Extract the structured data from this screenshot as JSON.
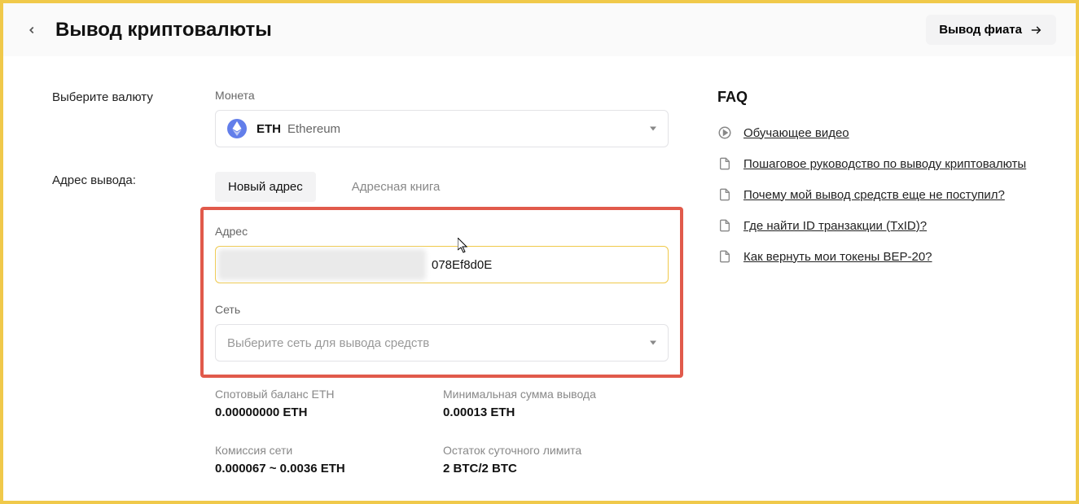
{
  "header": {
    "title": "Вывод криптовалюты",
    "fiat_button": "Вывод фиата"
  },
  "currency": {
    "section_label": "Выберите валюту",
    "field_caption": "Монета",
    "symbol": "ETH",
    "name": "Ethereum"
  },
  "withdraw": {
    "section_label": "Адрес вывода:",
    "tabs": {
      "new": "Новый адрес",
      "book": "Адресная книга"
    },
    "address_caption": "Адрес",
    "address_value": "078Ef8d0E",
    "network_caption": "Сеть",
    "network_placeholder": "Выберите сеть для вывода средств"
  },
  "stats": {
    "spot_label": "Спотовый баланс ETH",
    "spot_value": "0.00000000 ETH",
    "min_label": "Минимальная сумма вывода",
    "min_value": "0.00013 ETH",
    "fee_label": "Комиссия сети",
    "fee_value": "0.000067 ~ 0.0036 ETH",
    "limit_label": "Остаток суточного лимита",
    "limit_value": "2 BTC/2 BTC"
  },
  "faq": {
    "title": "FAQ",
    "items": [
      "Обучающее видео",
      "Пошаговое руководство по выводу криптовалюты",
      "Почему мой вывод средств еще не поступил?",
      "Где найти ID транзакции (TxID)?",
      "Как вернуть мои токены BEP-20?"
    ]
  }
}
